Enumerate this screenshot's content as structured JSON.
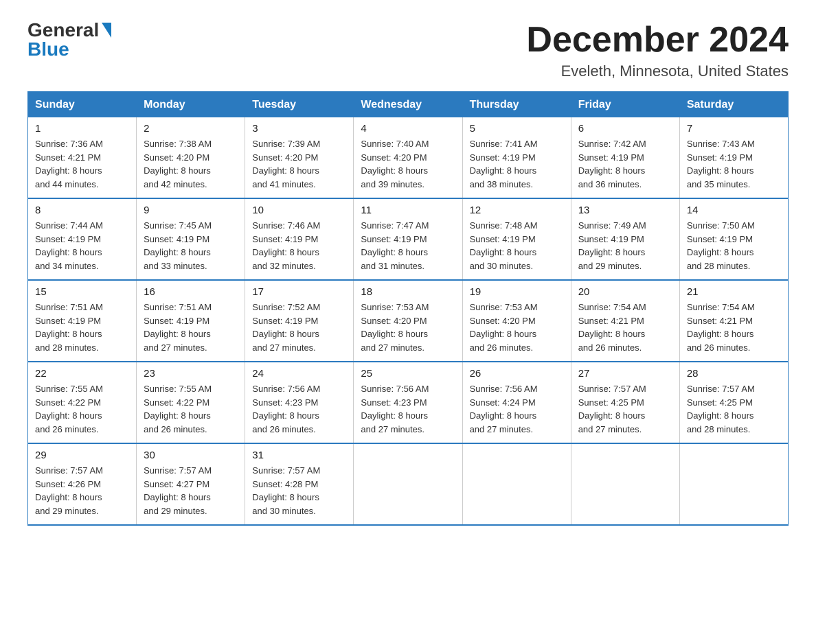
{
  "logo": {
    "general": "General",
    "blue": "Blue"
  },
  "title": "December 2024",
  "subtitle": "Eveleth, Minnesota, United States",
  "days_of_week": [
    "Sunday",
    "Monday",
    "Tuesday",
    "Wednesday",
    "Thursday",
    "Friday",
    "Saturday"
  ],
  "weeks": [
    [
      {
        "day": "1",
        "sunrise": "7:36 AM",
        "sunset": "4:21 PM",
        "daylight": "8 hours and 44 minutes."
      },
      {
        "day": "2",
        "sunrise": "7:38 AM",
        "sunset": "4:20 PM",
        "daylight": "8 hours and 42 minutes."
      },
      {
        "day": "3",
        "sunrise": "7:39 AM",
        "sunset": "4:20 PM",
        "daylight": "8 hours and 41 minutes."
      },
      {
        "day": "4",
        "sunrise": "7:40 AM",
        "sunset": "4:20 PM",
        "daylight": "8 hours and 39 minutes."
      },
      {
        "day": "5",
        "sunrise": "7:41 AM",
        "sunset": "4:19 PM",
        "daylight": "8 hours and 38 minutes."
      },
      {
        "day": "6",
        "sunrise": "7:42 AM",
        "sunset": "4:19 PM",
        "daylight": "8 hours and 36 minutes."
      },
      {
        "day": "7",
        "sunrise": "7:43 AM",
        "sunset": "4:19 PM",
        "daylight": "8 hours and 35 minutes."
      }
    ],
    [
      {
        "day": "8",
        "sunrise": "7:44 AM",
        "sunset": "4:19 PM",
        "daylight": "8 hours and 34 minutes."
      },
      {
        "day": "9",
        "sunrise": "7:45 AM",
        "sunset": "4:19 PM",
        "daylight": "8 hours and 33 minutes."
      },
      {
        "day": "10",
        "sunrise": "7:46 AM",
        "sunset": "4:19 PM",
        "daylight": "8 hours and 32 minutes."
      },
      {
        "day": "11",
        "sunrise": "7:47 AM",
        "sunset": "4:19 PM",
        "daylight": "8 hours and 31 minutes."
      },
      {
        "day": "12",
        "sunrise": "7:48 AM",
        "sunset": "4:19 PM",
        "daylight": "8 hours and 30 minutes."
      },
      {
        "day": "13",
        "sunrise": "7:49 AM",
        "sunset": "4:19 PM",
        "daylight": "8 hours and 29 minutes."
      },
      {
        "day": "14",
        "sunrise": "7:50 AM",
        "sunset": "4:19 PM",
        "daylight": "8 hours and 28 minutes."
      }
    ],
    [
      {
        "day": "15",
        "sunrise": "7:51 AM",
        "sunset": "4:19 PM",
        "daylight": "8 hours and 28 minutes."
      },
      {
        "day": "16",
        "sunrise": "7:51 AM",
        "sunset": "4:19 PM",
        "daylight": "8 hours and 27 minutes."
      },
      {
        "day": "17",
        "sunrise": "7:52 AM",
        "sunset": "4:19 PM",
        "daylight": "8 hours and 27 minutes."
      },
      {
        "day": "18",
        "sunrise": "7:53 AM",
        "sunset": "4:20 PM",
        "daylight": "8 hours and 27 minutes."
      },
      {
        "day": "19",
        "sunrise": "7:53 AM",
        "sunset": "4:20 PM",
        "daylight": "8 hours and 26 minutes."
      },
      {
        "day": "20",
        "sunrise": "7:54 AM",
        "sunset": "4:21 PM",
        "daylight": "8 hours and 26 minutes."
      },
      {
        "day": "21",
        "sunrise": "7:54 AM",
        "sunset": "4:21 PM",
        "daylight": "8 hours and 26 minutes."
      }
    ],
    [
      {
        "day": "22",
        "sunrise": "7:55 AM",
        "sunset": "4:22 PM",
        "daylight": "8 hours and 26 minutes."
      },
      {
        "day": "23",
        "sunrise": "7:55 AM",
        "sunset": "4:22 PM",
        "daylight": "8 hours and 26 minutes."
      },
      {
        "day": "24",
        "sunrise": "7:56 AM",
        "sunset": "4:23 PM",
        "daylight": "8 hours and 26 minutes."
      },
      {
        "day": "25",
        "sunrise": "7:56 AM",
        "sunset": "4:23 PM",
        "daylight": "8 hours and 27 minutes."
      },
      {
        "day": "26",
        "sunrise": "7:56 AM",
        "sunset": "4:24 PM",
        "daylight": "8 hours and 27 minutes."
      },
      {
        "day": "27",
        "sunrise": "7:57 AM",
        "sunset": "4:25 PM",
        "daylight": "8 hours and 27 minutes."
      },
      {
        "day": "28",
        "sunrise": "7:57 AM",
        "sunset": "4:25 PM",
        "daylight": "8 hours and 28 minutes."
      }
    ],
    [
      {
        "day": "29",
        "sunrise": "7:57 AM",
        "sunset": "4:26 PM",
        "daylight": "8 hours and 29 minutes."
      },
      {
        "day": "30",
        "sunrise": "7:57 AM",
        "sunset": "4:27 PM",
        "daylight": "8 hours and 29 minutes."
      },
      {
        "day": "31",
        "sunrise": "7:57 AM",
        "sunset": "4:28 PM",
        "daylight": "8 hours and 30 minutes."
      },
      null,
      null,
      null,
      null
    ]
  ],
  "labels": {
    "sunrise": "Sunrise:",
    "sunset": "Sunset:",
    "daylight": "Daylight:"
  }
}
